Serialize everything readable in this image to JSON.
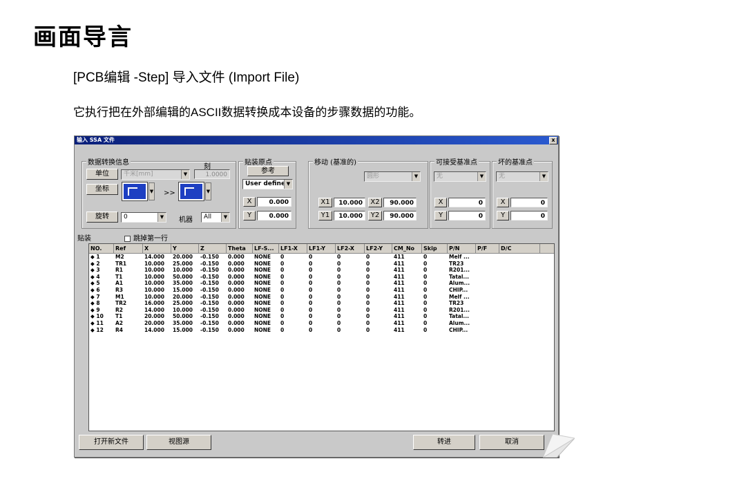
{
  "doc": {
    "title": "画面导言",
    "subtitle": "[PCB编辑 -Step] 导入文件 (Import File)",
    "description": "它执行把在外部编辑的ASCII数据转换成本设备的步骤数据的功能。"
  },
  "window": {
    "title": "输入 SSA 文件",
    "close": "x"
  },
  "convert": {
    "label": "数据转换信息",
    "unit_label": "单位",
    "unit_value": "千米[mm]",
    "scale_label": "刻",
    "scale_value": "1.0000",
    "coord_label": "坐标",
    "arrow": ">>",
    "rotate_label": "旋转",
    "rotate_value": "0",
    "machine_label": "机器",
    "machine_value": "All"
  },
  "origin": {
    "label": "贴装原点",
    "ref_label": "参考",
    "mode_value": "User defined",
    "x_label": "X",
    "x_value": "0.000",
    "y_label": "Y",
    "y_value": "0.000"
  },
  "move": {
    "label": "移动 (基准的)",
    "shape_value": "圆形",
    "x1_label": "X1",
    "x1_value": "10.000",
    "x2_label": "X2",
    "x2_value": "90.000",
    "y1_label": "Y1",
    "y1_value": "10.000",
    "y2_label": "Y2",
    "y2_value": "90.000"
  },
  "accept": {
    "label": "可接受基准点",
    "combo_value": "无",
    "x_label": "X",
    "x_value": "0",
    "y_label": "Y",
    "y_value": "0"
  },
  "bad": {
    "label": "坏的基准点",
    "combo_value": "无",
    "x_label": "X",
    "x_value": "0",
    "y_label": "Y",
    "y_value": "0"
  },
  "mount": {
    "label": "贴装",
    "skip_label": "跳掉第一行"
  },
  "table": {
    "headers": [
      "NO.",
      "Ref",
      "X",
      "Y",
      "Z",
      "Theta",
      "LF-S...",
      "LF1-X",
      "LF1-Y",
      "LF2-X",
      "LF2-Y",
      "CM_No",
      "Skip",
      "P/N",
      "P/F",
      "D/C"
    ],
    "rows": [
      [
        "◆ 1",
        "M2",
        "14.000",
        "20.000",
        "-0.150",
        "0.000",
        "NONE",
        "0",
        "0",
        "0",
        "0",
        "411",
        "0",
        "Melf ...",
        "",
        ""
      ],
      [
        "◆ 2",
        "TR1",
        "10.000",
        "25.000",
        "-0.150",
        "0.000",
        "NONE",
        "0",
        "0",
        "0",
        "0",
        "411",
        "0",
        "TR23",
        "",
        ""
      ],
      [
        "◆ 3",
        "R1",
        "10.000",
        "10.000",
        "-0.150",
        "0.000",
        "NONE",
        "0",
        "0",
        "0",
        "0",
        "411",
        "0",
        "R201...",
        "",
        ""
      ],
      [
        "◆ 4",
        "T1",
        "10.000",
        "50.000",
        "-0.150",
        "0.000",
        "NONE",
        "0",
        "0",
        "0",
        "0",
        "411",
        "0",
        "Tatal...",
        "",
        ""
      ],
      [
        "◆ 5",
        "A1",
        "10.000",
        "35.000",
        "-0.150",
        "0.000",
        "NONE",
        "0",
        "0",
        "0",
        "0",
        "411",
        "0",
        "Alum...",
        "",
        ""
      ],
      [
        "◆ 6",
        "R3",
        "10.000",
        "15.000",
        "-0.150",
        "0.000",
        "NONE",
        "0",
        "0",
        "0",
        "0",
        "411",
        "0",
        "CHIP...",
        "",
        ""
      ],
      [
        "◆ 7",
        "M1",
        "10.000",
        "20.000",
        "-0.150",
        "0.000",
        "NONE",
        "0",
        "0",
        "0",
        "0",
        "411",
        "0",
        "Melf ...",
        "",
        ""
      ],
      [
        "◆ 8",
        "TR2",
        "16.000",
        "25.000",
        "-0.150",
        "0.000",
        "NONE",
        "0",
        "0",
        "0",
        "0",
        "411",
        "0",
        "TR23",
        "",
        ""
      ],
      [
        "◆ 9",
        "R2",
        "14.000",
        "10.000",
        "-0.150",
        "0.000",
        "NONE",
        "0",
        "0",
        "0",
        "0",
        "411",
        "0",
        "R201...",
        "",
        ""
      ],
      [
        "◆ 10",
        "T1",
        "20.000",
        "50.000",
        "-0.150",
        "0.000",
        "NONE",
        "0",
        "0",
        "0",
        "0",
        "411",
        "0",
        "Tatal...",
        "",
        ""
      ],
      [
        "◆ 11",
        "A2",
        "20.000",
        "35.000",
        "-0.150",
        "0.000",
        "NONE",
        "0",
        "0",
        "0",
        "0",
        "411",
        "0",
        "Alum...",
        "",
        ""
      ],
      [
        "◆ 12",
        "R4",
        "14.000",
        "15.000",
        "-0.150",
        "0.000",
        "NONE",
        "0",
        "0",
        "0",
        "0",
        "411",
        "0",
        "CHIP...",
        "",
        ""
      ]
    ]
  },
  "buttons": {
    "open_new": "打开新文件",
    "view_source": "视图源",
    "convert": "转进",
    "cancel": "取消"
  }
}
